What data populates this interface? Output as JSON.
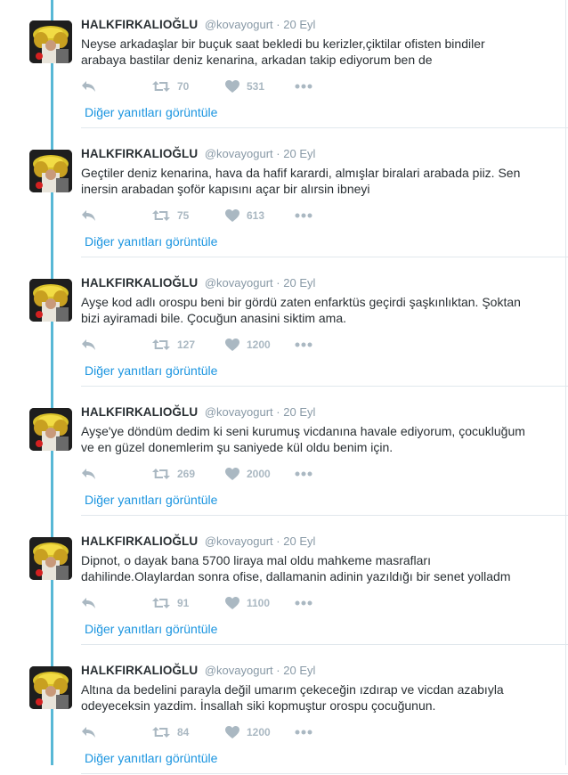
{
  "colors": {
    "thread_line": "#58b8d6",
    "link": "#1b95e0",
    "action_gray": "#aab8c2",
    "meta_gray": "#8899a6"
  },
  "icons": {
    "reply": "reply-icon",
    "retweet": "retweet-icon",
    "like": "heart-icon",
    "more": "more-dots-icon"
  },
  "tweets": [
    {
      "name": "HALKFIRKALIOĞLU",
      "handle": "@kovayogurt",
      "dot": "·",
      "time": "20 Eyl",
      "text": "Neyse arkadaşlar bir buçuk saat bekledi bu kerizler,çiktilar ofisten bindiler arabaya bastilar deniz kenarina, arkadan takip ediyorum ben de",
      "retweets": "70",
      "likes": "531",
      "more_replies": "Diğer yanıtları görüntüle"
    },
    {
      "name": "HALKFIRKALIOĞLU",
      "handle": "@kovayogurt",
      "dot": "·",
      "time": "20 Eyl",
      "text": "Geçtiler deniz kenarina, hava da hafif karardi, almışlar biralari arabada piiz. Sen inersin arabadan şoför kapısını açar bir alırsin ibneyi",
      "retweets": "75",
      "likes": "613",
      "more_replies": "Diğer yanıtları görüntüle"
    },
    {
      "name": "HALKFIRKALIOĞLU",
      "handle": "@kovayogurt",
      "dot": "·",
      "time": "20 Eyl",
      "text": "Ayşe kod adlı orospu beni bir gördü zaten enfarktüs geçirdi şaşkınlıktan. Şoktan bizi ayiramadi bile. Çocuğun anasini siktim ama.",
      "retweets": "127",
      "likes": "1200",
      "more_replies": "Diğer yanıtları görüntüle"
    },
    {
      "name": "HALKFIRKALIOĞLU",
      "handle": "@kovayogurt",
      "dot": "·",
      "time": "20 Eyl",
      "text": "Ayşe'ye döndüm dedim ki seni kurumuş vicdanına havale ediyorum, çocukluğum ve en güzel donemlerim şu saniyede kül oldu benim için.",
      "retweets": "269",
      "likes": "2000",
      "more_replies": "Diğer yanıtları görüntüle"
    },
    {
      "name": "HALKFIRKALIOĞLU",
      "handle": "@kovayogurt",
      "dot": "·",
      "time": "20 Eyl",
      "text": "Dipnot, o dayak bana 5700 liraya mal oldu mahkeme masrafları dahilinde.Olaylardan sonra ofise, dallamanin adinin yazıldığı bir senet yolladm",
      "retweets": "91",
      "likes": "1100",
      "more_replies": "Diğer yanıtları görüntüle"
    },
    {
      "name": "HALKFIRKALIOĞLU",
      "handle": "@kovayogurt",
      "dot": "·",
      "time": "20 Eyl",
      "text": "Altına da bedelini parayla değil umarım çekeceğin ızdırap ve vicdan azabıyla odeyeceksin yazdim. İnsallah siki kopmuştur orospu çocuğunun.",
      "retweets": "84",
      "likes": "1200",
      "more_replies": "Diğer yanıtları görüntüle"
    }
  ]
}
